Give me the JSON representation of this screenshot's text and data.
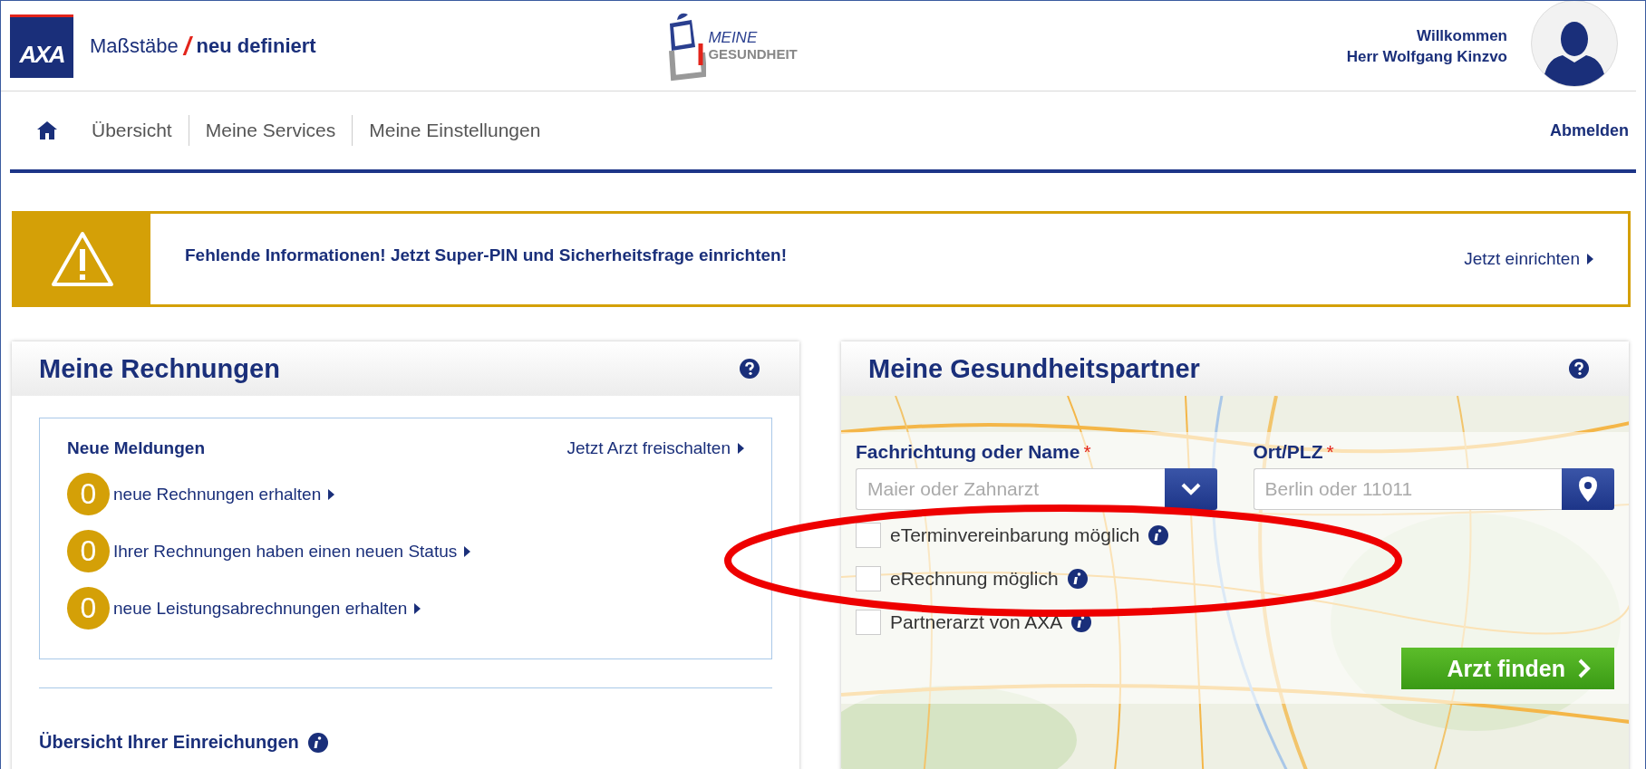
{
  "header": {
    "logo": "AXA",
    "tagline_main": "Maßstäbe",
    "tagline_slash": "/",
    "tagline_accent": "neu definiert",
    "app_logo_top": "MEINE",
    "app_logo_bottom": "GESUNDHEIT",
    "welcome": "Willkommen",
    "user_name": "Herr Wolfgang Kinzvo"
  },
  "nav": {
    "items": [
      {
        "label": "Übersicht"
      },
      {
        "label": "Meine Services"
      },
      {
        "label": "Meine Einstellungen"
      }
    ],
    "logout": "Abmelden"
  },
  "alert": {
    "message": "Fehlende Informationen! Jetzt Super-PIN und Sicherheitsfrage einrichten!",
    "action": "Jetzt einrichten"
  },
  "invoices_panel": {
    "title": "Meine Rechnungen",
    "notices": {
      "heading": "Neue Meldungen",
      "link": "Jetzt Arzt freischalten",
      "items": [
        {
          "count": "0",
          "text": "neue Rechnungen erhalten"
        },
        {
          "count": "0",
          "text": "Ihrer Rechnungen haben einen neuen Status"
        },
        {
          "count": "0",
          "text": "neue Leistungsabrechnungen erhalten"
        }
      ]
    },
    "submissions_heading": "Übersicht Ihrer Einreichungen"
  },
  "partners_panel": {
    "title": "Meine Gesundheitspartner",
    "fields": [
      {
        "label": "Fachrichtung oder Name",
        "required_mark": "*",
        "placeholder": "Maier oder Zahnarzt",
        "kind": "dropdown"
      },
      {
        "label": "Ort/PLZ",
        "required_mark": "*",
        "placeholder": "Berlin oder 11011",
        "kind": "location"
      }
    ],
    "checkboxes": [
      {
        "label": "eTerminvereinbarung möglich",
        "checked": false
      },
      {
        "label": "eRechnung möglich",
        "checked": false
      },
      {
        "label": "Partnerarzt von AXA",
        "checked": false
      }
    ],
    "button": "Arzt finden"
  },
  "annotation": {
    "kind": "ellipse"
  }
}
